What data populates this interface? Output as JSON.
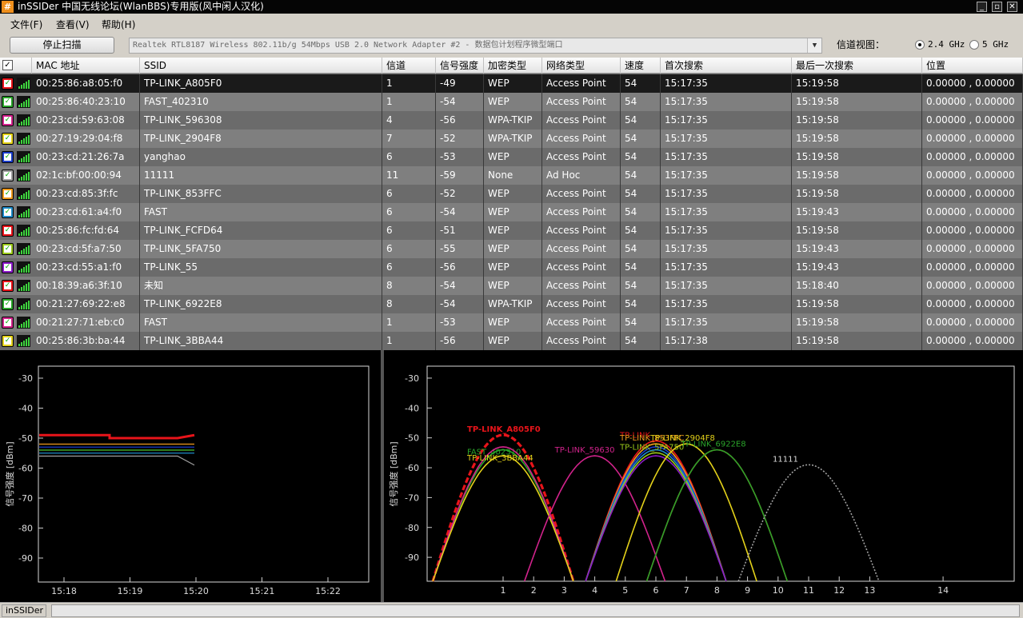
{
  "window": {
    "title": "inSSIDer 中国无线论坛(WlanBBS)专用版(风中闲人汉化)",
    "min_icon": "minimize-icon",
    "max_icon": "maximize-icon",
    "close_icon": "close-icon"
  },
  "menu": [
    {
      "label": "文件(F)"
    },
    {
      "label": "查看(V)"
    },
    {
      "label": "帮助(H)"
    }
  ],
  "toolbar": {
    "scan_button": "停止扫描",
    "adapter": "Realtek RTL8187 Wireless 802.11b/g 54Mbps USB 2.0 Network Adapter #2 - 数据包计划程序微型端口",
    "channel_view_label": "信道视图：",
    "band_24": "2.4 GHz",
    "band_5": "5 GHz",
    "selected_band": "2.4 GHz"
  },
  "table": {
    "columns": [
      "MAC 地址",
      "SSID",
      "信道",
      "信号强度",
      "加密类型",
      "网络类型",
      "速度",
      "首次搜索",
      "最后一次搜索",
      "位置"
    ],
    "rows": [
      {
        "color": "#e8141a",
        "mac": "00:25:86:a8:05:f0",
        "ssid": "TP-LINK_A805F0",
        "channel": "1",
        "rssi": "-49",
        "enc": "WEP",
        "type": "Access Point",
        "speed": "54",
        "first": "15:17:35",
        "last": "15:19:58",
        "loc": "0.00000 , 0.00000"
      },
      {
        "color": "#2aa42a",
        "mac": "00:25:86:40:23:10",
        "ssid": "FAST_402310",
        "channel": "1",
        "rssi": "-54",
        "enc": "WEP",
        "type": "Access Point",
        "speed": "54",
        "first": "15:17:35",
        "last": "15:19:58",
        "loc": "0.00000 , 0.00000"
      },
      {
        "color": "#d2238c",
        "mac": "00:23:cd:59:63:08",
        "ssid": "TP-LINK_596308",
        "channel": "4",
        "rssi": "-56",
        "enc": "WPA-TKIP",
        "type": "Access Point",
        "speed": "54",
        "first": "15:17:35",
        "last": "15:19:58",
        "loc": "0.00000 , 0.00000"
      },
      {
        "color": "#e4d21a",
        "mac": "00:27:19:29:04:f8",
        "ssid": "TP-LINK_2904F8",
        "channel": "7",
        "rssi": "-52",
        "enc": "WPA-TKIP",
        "type": "Access Point",
        "speed": "54",
        "first": "15:17:35",
        "last": "15:19:58",
        "loc": "0.00000 , 0.00000"
      },
      {
        "color": "#1a3cc8",
        "mac": "00:23:cd:21:26:7a",
        "ssid": "yanghao",
        "channel": "6",
        "rssi": "-53",
        "enc": "WEP",
        "type": "Access Point",
        "speed": "54",
        "first": "15:17:35",
        "last": "15:19:58",
        "loc": "0.00000 , 0.00000"
      },
      {
        "color": "#a0a0a0",
        "mac": "02:1c:bf:00:00:94",
        "ssid": "11111",
        "channel": "11",
        "rssi": "-59",
        "enc": "None",
        "type": "Ad Hoc",
        "speed": "54",
        "first": "15:17:35",
        "last": "15:19:58",
        "loc": "0.00000 , 0.00000"
      },
      {
        "color": "#f09a1c",
        "mac": "00:23:cd:85:3f:fc",
        "ssid": "TP-LINK_853FFC",
        "channel": "6",
        "rssi": "-52",
        "enc": "WEP",
        "type": "Access Point",
        "speed": "54",
        "first": "15:17:35",
        "last": "15:19:58",
        "loc": "0.00000 , 0.00000"
      },
      {
        "color": "#1e8ac8",
        "mac": "00:23:cd:61:a4:f0",
        "ssid": "FAST",
        "channel": "6",
        "rssi": "-54",
        "enc": "WEP",
        "type": "Access Point",
        "speed": "54",
        "first": "15:17:35",
        "last": "15:19:43",
        "loc": "0.00000 , 0.00000"
      },
      {
        "color": "#e8141a",
        "mac": "00:25:86:fc:fd:64",
        "ssid": "TP-LINK_FCFD64",
        "channel": "6",
        "rssi": "-51",
        "enc": "WEP",
        "type": "Access Point",
        "speed": "54",
        "first": "15:17:35",
        "last": "15:19:58",
        "loc": "0.00000 , 0.00000"
      },
      {
        "color": "#9ac81a",
        "mac": "00:23:cd:5f:a7:50",
        "ssid": "TP-LINK_5FA750",
        "channel": "6",
        "rssi": "-55",
        "enc": "WEP",
        "type": "Access Point",
        "speed": "54",
        "first": "15:17:35",
        "last": "15:19:43",
        "loc": "0.00000 , 0.00000"
      },
      {
        "color": "#8a1ac8",
        "mac": "00:23:cd:55:a1:f0",
        "ssid": "TP-LINK_55",
        "channel": "6",
        "rssi": "-56",
        "enc": "WEP",
        "type": "Access Point",
        "speed": "54",
        "first": "15:17:35",
        "last": "15:19:43",
        "loc": "0.00000 , 0.00000"
      },
      {
        "color": "#e8141a",
        "mac": "00:18:39:a6:3f:10",
        "ssid": "未知",
        "channel": "8",
        "rssi": "-54",
        "enc": "WEP",
        "type": "Access Point",
        "speed": "54",
        "first": "15:17:35",
        "last": "15:18:40",
        "loc": "0.00000 , 0.00000"
      },
      {
        "color": "#2aa42a",
        "mac": "00:21:27:69:22:e8",
        "ssid": "TP-LINK_6922E8",
        "channel": "8",
        "rssi": "-54",
        "enc": "WPA-TKIP",
        "type": "Access Point",
        "speed": "54",
        "first": "15:17:35",
        "last": "15:19:58",
        "loc": "0.00000 , 0.00000"
      },
      {
        "color": "#d2238c",
        "mac": "00:21:27:71:eb:c0",
        "ssid": "FAST",
        "channel": "1",
        "rssi": "-53",
        "enc": "WEP",
        "type": "Access Point",
        "speed": "54",
        "first": "15:17:35",
        "last": "15:19:58",
        "loc": "0.00000 , 0.00000"
      },
      {
        "color": "#e4d21a",
        "mac": "00:25:86:3b:ba:44",
        "ssid": "TP-LINK_3BBA44",
        "channel": "1",
        "rssi": "-56",
        "enc": "WEP",
        "type": "Access Point",
        "speed": "54",
        "first": "15:17:38",
        "last": "15:19:58",
        "loc": "0.00000 , 0.00000"
      }
    ]
  },
  "chart_data": [
    {
      "type": "line",
      "ylabel": "信号强度 [dBm]",
      "x_ticks": [
        "15:18",
        "15:19",
        "15:20",
        "15:21",
        "15:22"
      ],
      "y_ticks": [
        -30,
        -40,
        -50,
        -60,
        -70,
        -80,
        -90
      ],
      "ylim": [
        -98,
        -26
      ],
      "grid": false,
      "series": [
        {
          "color": "#e8141a",
          "values": [
            -49,
            -49,
            -50,
            -50,
            -50,
            -49
          ]
        },
        {
          "color": "#f09a1c",
          "values": [
            -52,
            -52,
            -52,
            -52,
            -52,
            -52
          ]
        },
        {
          "color": "#1a3cc8",
          "values": [
            -53,
            -53,
            -53,
            -53,
            -53,
            -53
          ]
        },
        {
          "color": "#e4d21a",
          "values": [
            -54,
            -54,
            -54,
            -54,
            -54,
            -54
          ]
        },
        {
          "color": "#2aa42a",
          "values": [
            -54,
            -54,
            -54,
            -54,
            -54,
            -54
          ]
        },
        {
          "color": "#1e8ac8",
          "values": [
            -55,
            -55,
            -55,
            -55,
            -55,
            -55
          ]
        },
        {
          "color": "#a0a0a0",
          "values": [
            -56,
            -56,
            -56,
            -56,
            -56,
            -59
          ]
        }
      ]
    },
    {
      "type": "area",
      "ylabel": "信号强度 [dBm]",
      "x_ticks": [
        "1",
        "2",
        "3",
        "4",
        "5",
        "6",
        "7",
        "8",
        "9",
        "10",
        "11",
        "12",
        "13",
        "14"
      ],
      "y_ticks": [
        -30,
        -40,
        -50,
        -60,
        -70,
        -80,
        -90
      ],
      "ylim": [
        -98,
        -26
      ],
      "grid": false,
      "series": [
        {
          "ssid": "TP-LINK_A805F0",
          "channel": 1,
          "rssi": -49,
          "color": "#e8141a",
          "label": "TP-LINK_A805F0"
        },
        {
          "ssid": "FAST_402310",
          "channel": 1,
          "rssi": -54,
          "color": "#2aa42a",
          "label": "FAST_402310"
        },
        {
          "ssid": "FAST",
          "channel": 1,
          "rssi": -53,
          "color": "#d2238c",
          "label": ""
        },
        {
          "ssid": "TP-LINK_3BBA44",
          "channel": 1,
          "rssi": -56,
          "color": "#e4d21a",
          "label": "TP-LINK_3BBA44"
        },
        {
          "ssid": "TP-LINK_596308",
          "channel": 4,
          "rssi": -56,
          "color": "#d2238c",
          "label": "TP-LINK_59630"
        },
        {
          "ssid": "TP-LINK_FCFD64",
          "channel": 6,
          "rssi": -51,
          "color": "#e8141a",
          "label": "TP-LINK"
        },
        {
          "ssid": "TP-LINK_853FFC",
          "channel": 6,
          "rssi": -52,
          "color": "#f09a1c",
          "label": "TP-LINK_853FFC"
        },
        {
          "ssid": "yanghao",
          "channel": 6,
          "rssi": -53,
          "color": "#1a3cc8",
          "label": ""
        },
        {
          "ssid": "FAST",
          "channel": 6,
          "rssi": -54,
          "color": "#1e8ac8",
          "label": ""
        },
        {
          "ssid": "TP-LINK_5FA750",
          "channel": 6,
          "rssi": -55,
          "color": "#9ac81a",
          "label": "TP-LINK_5FA750"
        },
        {
          "ssid": "TP-LINK_55",
          "channel": 6,
          "rssi": -56,
          "color": "#8a1ac8",
          "label": ""
        },
        {
          "ssid": "TP-LINK_2904F8",
          "channel": 7,
          "rssi": -52,
          "color": "#e4d21a",
          "label": "TP-LINK_2904F8"
        },
        {
          "ssid": "未知",
          "channel": 8,
          "rssi": -54,
          "color": "#e8141a",
          "label": ""
        },
        {
          "ssid": "TP-LINK_6922E8",
          "channel": 8,
          "rssi": -54,
          "color": "#2aa42a",
          "label": "TP-LINK_6922E8"
        },
        {
          "ssid": "11111",
          "channel": 11,
          "rssi": -59,
          "color": "#a0a0a0",
          "label": "11111"
        }
      ]
    }
  ],
  "statusbar": {
    "text": "inSSIDer"
  }
}
